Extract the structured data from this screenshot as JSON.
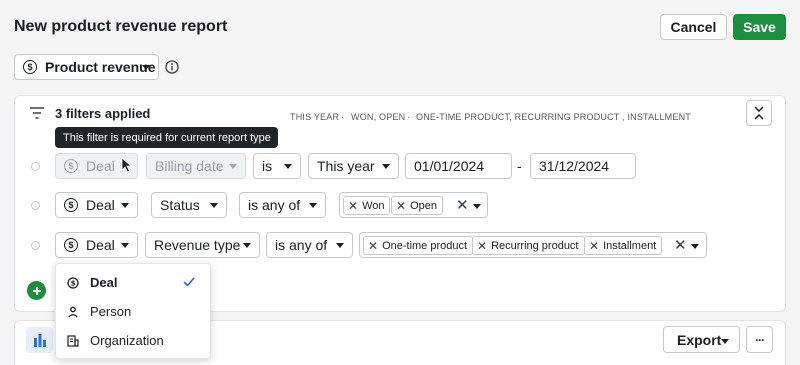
{
  "page_title": "New product revenue report",
  "buttons": {
    "cancel": "Cancel",
    "save": "Save",
    "export": "Export",
    "more": "···"
  },
  "report_type": {
    "label": "Product revenue",
    "icon": "dollar-circle-icon"
  },
  "filters": {
    "count_label": "3 filters applied",
    "summary": [
      "THIS YEAR",
      "WON, OPEN",
      "ONE-TIME PRODUCT, RECURRING PRODUCT , INSTALLMENT"
    ],
    "summary_separator": "·",
    "tooltip": "This filter is required for current report type",
    "rows": [
      {
        "entity": "Deal",
        "field": "Billing date",
        "operator": "is",
        "value": "This year",
        "date_from": "01/01/2024",
        "date_sep": "-",
        "date_to": "31/12/2024"
      },
      {
        "entity": "Deal",
        "field": "Status",
        "operator": "is any of",
        "chips": [
          "Won",
          "Open"
        ]
      },
      {
        "entity": "Deal",
        "field": "Revenue type",
        "operator": "is any of",
        "chips": [
          "One-time product",
          "Recurring product",
          "Installment"
        ]
      }
    ],
    "add_icon": "plus-icon"
  },
  "entity_menu": {
    "items": [
      {
        "label": "Deal",
        "icon": "dollar-circle-icon",
        "selected": true
      },
      {
        "label": "Person",
        "icon": "person-icon",
        "selected": false
      },
      {
        "label": "Organization",
        "icon": "building-icon",
        "selected": false
      }
    ]
  },
  "colors": {
    "accent": "#1f8d3f",
    "check": "#2164d8",
    "chart_icon": "#2f6fd8",
    "tooltip_bg": "#202328"
  }
}
